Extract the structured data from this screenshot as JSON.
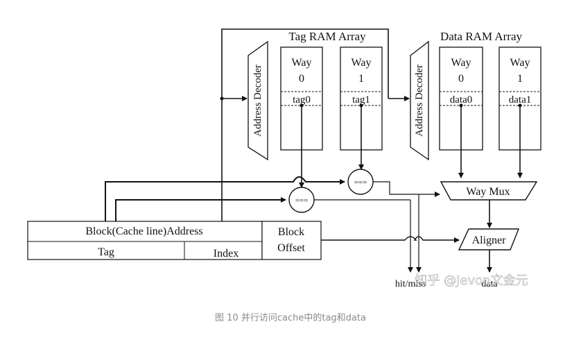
{
  "tag_array_title": "Tag RAM Array",
  "data_array_title": "Data RAM Array",
  "decoder_label": "Address Decoder",
  "tag_way0": {
    "way": "Way",
    "num": "0",
    "cell": "tag0"
  },
  "tag_way1": {
    "way": "Way",
    "num": "1",
    "cell": "tag1"
  },
  "data_way0": {
    "way": "Way",
    "num": "0",
    "cell": "data0"
  },
  "data_way1": {
    "way": "Way",
    "num": "1",
    "cell": "data1"
  },
  "comparator_label": "===",
  "way_mux": "Way Mux",
  "aligner": "Aligner",
  "address_block": "Block(Cache line)Address",
  "tag_field": "Tag",
  "index_field": "Index",
  "offset_field_line1": "Block",
  "offset_field_line2": "Offset",
  "hit_output": "hit/miss",
  "data_output": "data",
  "watermark": "知乎 @Jevon文金元",
  "caption": "图 10 并行访问cache中的tag和data"
}
